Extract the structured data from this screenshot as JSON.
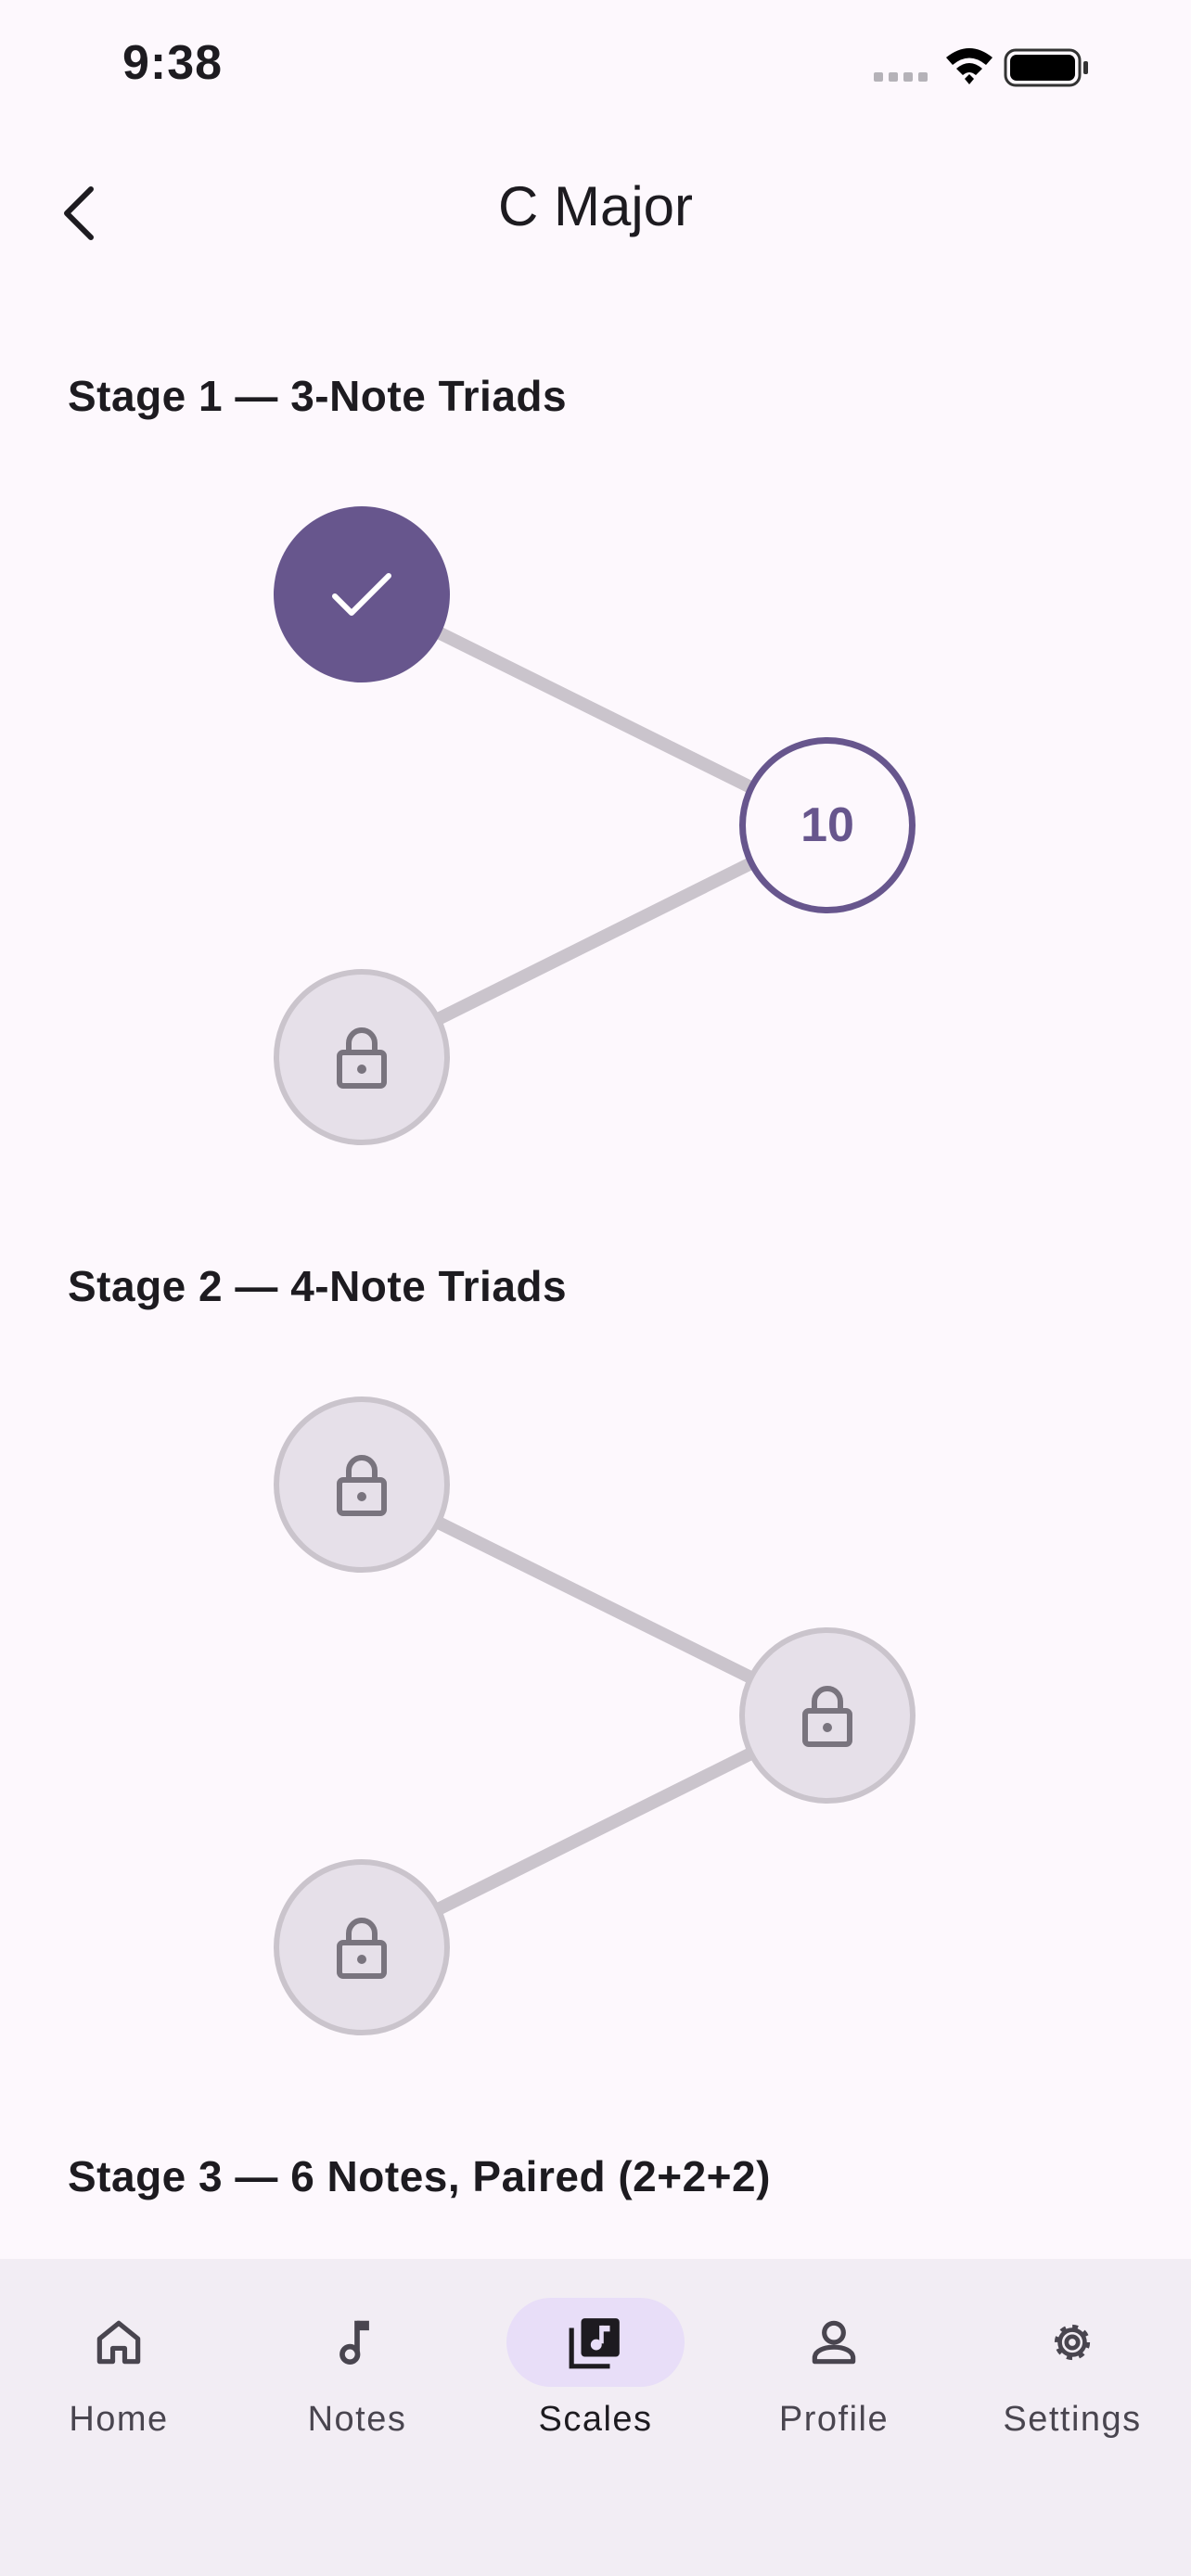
{
  "status": {
    "time": "9:38"
  },
  "header": {
    "title": "C Major"
  },
  "stages": [
    {
      "title": "Stage 1 — 3-Note Triads",
      "nodes": [
        {
          "state": "completed",
          "icon": "check-icon"
        },
        {
          "state": "current",
          "count": "10"
        },
        {
          "state": "locked",
          "icon": "lock-icon"
        }
      ]
    },
    {
      "title": "Stage 2 — 4-Note Triads",
      "nodes": [
        {
          "state": "locked",
          "icon": "lock-icon"
        },
        {
          "state": "locked",
          "icon": "lock-icon"
        },
        {
          "state": "locked",
          "icon": "lock-icon"
        }
      ]
    },
    {
      "title": "Stage 3 — 6 Notes, Paired (2+2+2)"
    }
  ],
  "nav": {
    "items": [
      {
        "label": "Home",
        "icon": "home-icon"
      },
      {
        "label": "Notes",
        "icon": "music-note-icon"
      },
      {
        "label": "Scales",
        "icon": "library-music-icon",
        "active": true
      },
      {
        "label": "Profile",
        "icon": "person-icon"
      },
      {
        "label": "Settings",
        "icon": "gear-icon"
      }
    ]
  },
  "colors": {
    "background": "#FDF8FD",
    "accent": "#67568D",
    "locked_fill": "#E6E0E9",
    "locked_border": "#CAC4CC",
    "nav_background": "#F2EDF4",
    "nav_active_pill": "#E8DEF8"
  }
}
